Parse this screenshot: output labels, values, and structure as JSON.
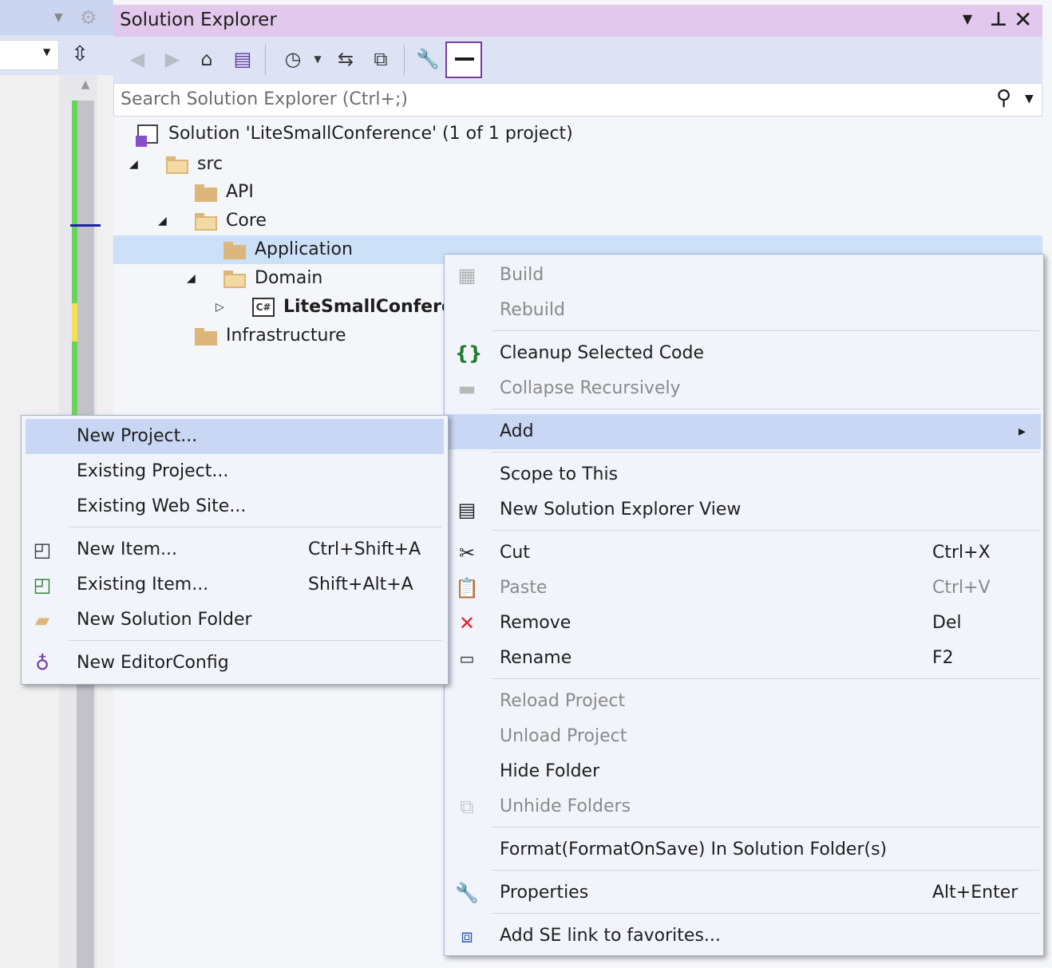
{
  "solution_explorer": {
    "title": "Solution Explorer",
    "search_placeholder": "Search Solution Explorer (Ctrl+;)"
  },
  "tree": {
    "solution_label": "Solution 'LiteSmallConference' (1 of 1 project)",
    "src": "src",
    "api": "API",
    "core": "Core",
    "application": "Application",
    "domain": "Domain",
    "project": "LiteSmallConferen",
    "project_badge": "C#",
    "infrastructure": "Infrastructure"
  },
  "context_menu": {
    "build": "Build",
    "rebuild": "Rebuild",
    "cleanup": "Cleanup Selected Code",
    "collapse": "Collapse Recursively",
    "add": "Add",
    "scope": "Scope to This",
    "new_view": "New Solution Explorer View",
    "cut": "Cut",
    "cut_key": "Ctrl+X",
    "paste": "Paste",
    "paste_key": "Ctrl+V",
    "remove": "Remove",
    "remove_key": "Del",
    "rename": "Rename",
    "rename_key": "F2",
    "reload": "Reload Project",
    "unload": "Unload Project",
    "hide": "Hide Folder",
    "unhide": "Unhide Folders",
    "format": "Format(FormatOnSave) In Solution Folder(s)",
    "properties": "Properties",
    "properties_key": "Alt+Enter",
    "add_se_link": "Add SE link to favorites..."
  },
  "add_submenu": {
    "new_project": "New Project...",
    "existing_project": "Existing Project...",
    "existing_web_site": "Existing Web Site...",
    "new_item": "New Item...",
    "new_item_key": "Ctrl+Shift+A",
    "existing_item": "Existing Item...",
    "existing_item_key": "Shift+Alt+A",
    "new_solution_folder": "New Solution Folder",
    "new_editorconfig": "New EditorConfig"
  },
  "icons": {
    "close": "✕",
    "dropdown": "▼",
    "search": "⚲",
    "submenu_arrow": "▸"
  }
}
